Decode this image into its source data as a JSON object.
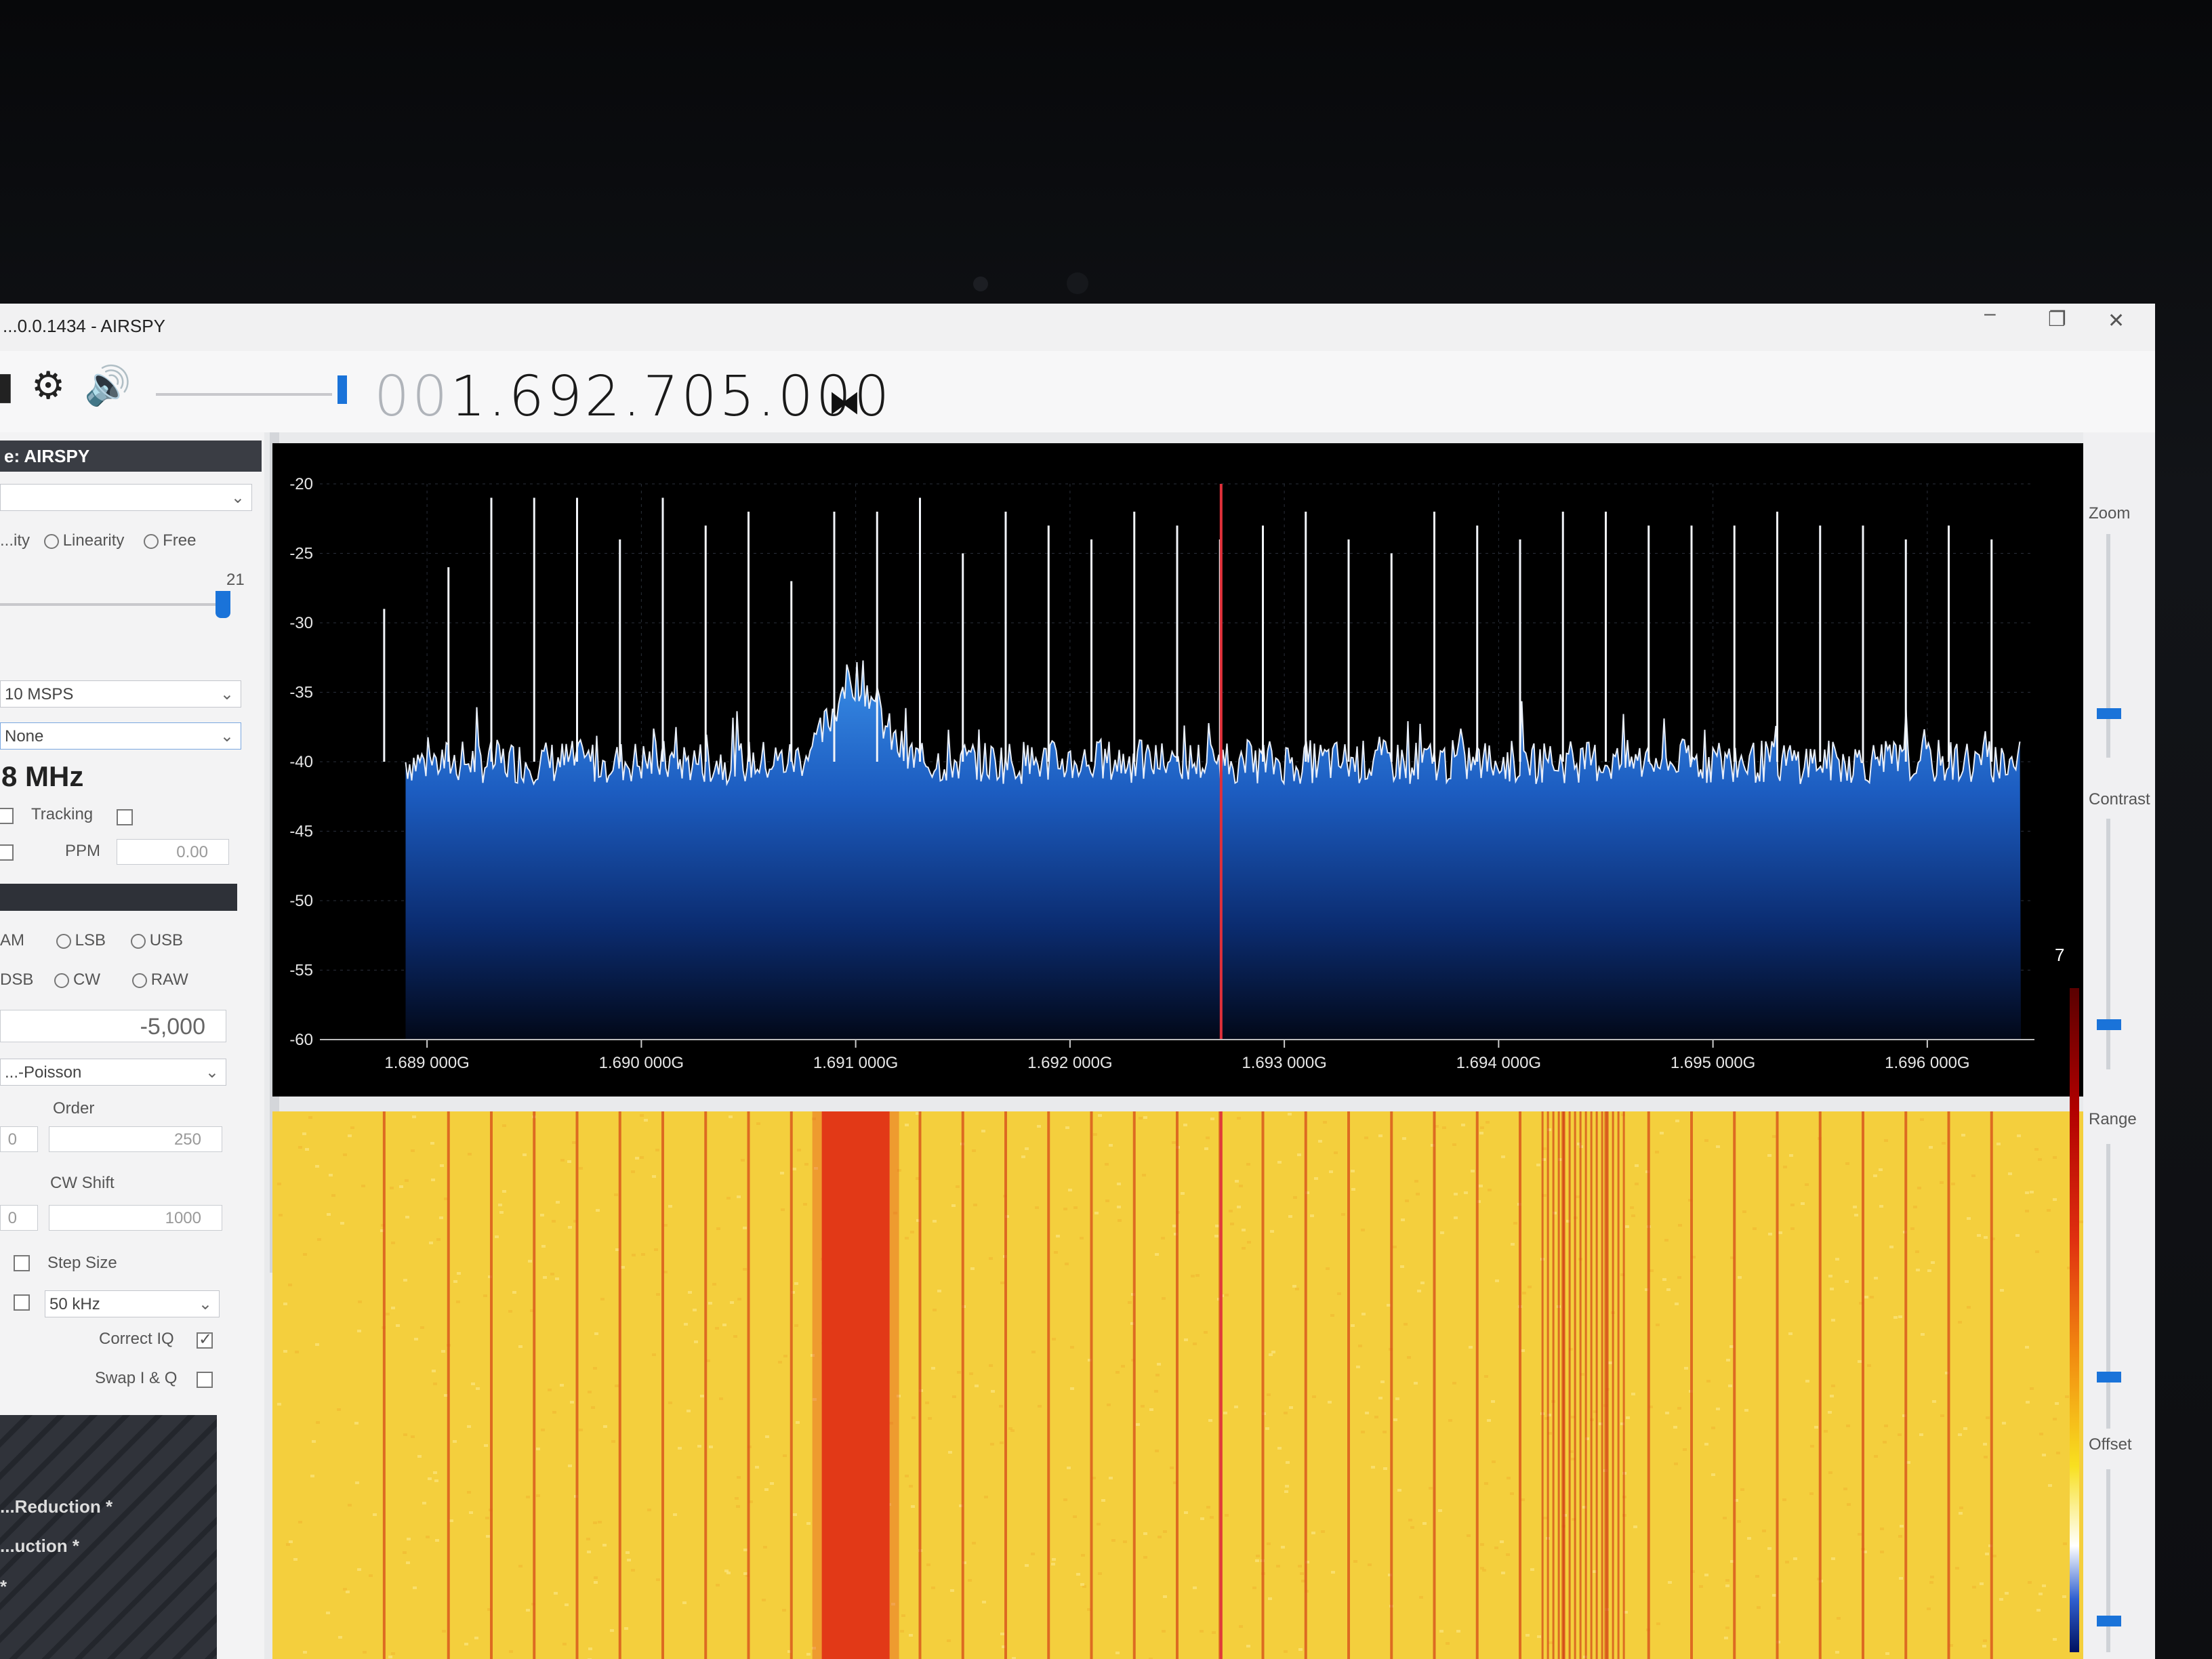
{
  "window": {
    "title": "...0.0.1434 - AIRSPY",
    "minimize": "–",
    "restore": "❐",
    "close": "✕"
  },
  "toolbar": {
    "icons": [
      "menu-icon",
      "gear-icon",
      "speaker-icon"
    ],
    "freq_leading": "00",
    "freq_main": "1.692.705.000"
  },
  "source_panel": {
    "header": "e: AIRSPY",
    "gain_mode": {
      "options": [
        "...ity",
        "Linearity",
        "Free"
      ]
    },
    "gain_value": "21",
    "sample_rate": "10 MSPS",
    "decimation": "None",
    "bandwidth": "8 MHz",
    "tracking_label": "Tracking",
    "ppm_label": "PPM",
    "ppm_value": "0.00"
  },
  "radio_panel": {
    "modes_row1": [
      "AM",
      "LSB",
      "USB"
    ],
    "modes_row2": [
      "DSB",
      "CW",
      "RAW"
    ],
    "shift_value": "-5,000",
    "window": "...-Poisson",
    "order_label": "Order",
    "order_left": "0",
    "order_value": "250",
    "cw_shift_label": "CW Shift",
    "cw_left": "0",
    "cw_value": "1000",
    "step_size_label": "Step Size",
    "step_size_value": "50 kHz",
    "correct_iq_label": "Correct IQ",
    "swap_iq_label": "Swap I & Q"
  },
  "collapsed_panels": [
    "...Reduction *",
    "...uction *",
    "*"
  ],
  "right_panel": {
    "zoom_label": "Zoom",
    "contrast_label": "Contrast",
    "range_label": "Range",
    "offset_label": "Offset",
    "zoom_level": 0.22,
    "contrast_level": 0.2,
    "range_level": 0.2,
    "offset_level": 0.2,
    "cursor_readout": "7"
  },
  "chart_data": {
    "type": "line",
    "title": "",
    "xlabel": "",
    "ylabel": "",
    "x_unit": "GHz",
    "xlim": [
      1.6885,
      1.6965
    ],
    "ylim": [
      -60,
      -20
    ],
    "y_ticks": [
      -20,
      -25,
      -30,
      -35,
      -40,
      -45,
      -50,
      -55,
      -60
    ],
    "x_ticks": [
      "1.689 000G",
      "1.690 000G",
      "1.691 000G",
      "1.692 000G",
      "1.693 000G",
      "1.694 000G",
      "1.695 000G",
      "1.696 000G"
    ],
    "x_tick_values": [
      1.689,
      1.69,
      1.691,
      1.692,
      1.693,
      1.694,
      1.695,
      1.696
    ],
    "grid": true,
    "noise_floor_db": -40,
    "tuned_frequency": 1.692705,
    "hump": {
      "center": 1.691,
      "width": 0.0003,
      "peak_db": -34
    },
    "spurs": [
      {
        "f": 1.6888,
        "db": -29
      },
      {
        "f": 1.6891,
        "db": -26
      },
      {
        "f": 1.6893,
        "db": -21
      },
      {
        "f": 1.6895,
        "db": -21
      },
      {
        "f": 1.6897,
        "db": -21
      },
      {
        "f": 1.6899,
        "db": -24
      },
      {
        "f": 1.6901,
        "db": -21
      },
      {
        "f": 1.6903,
        "db": -23
      },
      {
        "f": 1.6905,
        "db": -22
      },
      {
        "f": 1.6907,
        "db": -27
      },
      {
        "f": 1.6909,
        "db": -22
      },
      {
        "f": 1.6911,
        "db": -22
      },
      {
        "f": 1.6913,
        "db": -21
      },
      {
        "f": 1.6915,
        "db": -25
      },
      {
        "f": 1.6917,
        "db": -22
      },
      {
        "f": 1.6919,
        "db": -23
      },
      {
        "f": 1.6921,
        "db": -24
      },
      {
        "f": 1.6923,
        "db": -22
      },
      {
        "f": 1.6925,
        "db": -23
      },
      {
        "f": 1.6927,
        "db": -24
      },
      {
        "f": 1.6929,
        "db": -23
      },
      {
        "f": 1.6931,
        "db": -22
      },
      {
        "f": 1.6933,
        "db": -24
      },
      {
        "f": 1.6935,
        "db": -25
      },
      {
        "f": 1.6937,
        "db": -22
      },
      {
        "f": 1.6939,
        "db": -23
      },
      {
        "f": 1.6941,
        "db": -24
      },
      {
        "f": 1.6943,
        "db": -22
      },
      {
        "f": 1.6945,
        "db": -22
      },
      {
        "f": 1.6947,
        "db": -23
      },
      {
        "f": 1.6949,
        "db": -23
      },
      {
        "f": 1.6951,
        "db": -23
      },
      {
        "f": 1.6953,
        "db": -22
      },
      {
        "f": 1.6955,
        "db": -23
      },
      {
        "f": 1.6957,
        "db": -23
      },
      {
        "f": 1.6959,
        "db": -24
      },
      {
        "f": 1.6961,
        "db": -23
      },
      {
        "f": 1.6963,
        "db": -24
      }
    ]
  },
  "waterfall": {
    "background_color": "#f4cf3d",
    "strong_band_center": 1.691,
    "strong_band_color": "#e23a18",
    "busy_region": [
      1.6942,
      1.6946
    ],
    "marker_color": "#e03a3a"
  }
}
